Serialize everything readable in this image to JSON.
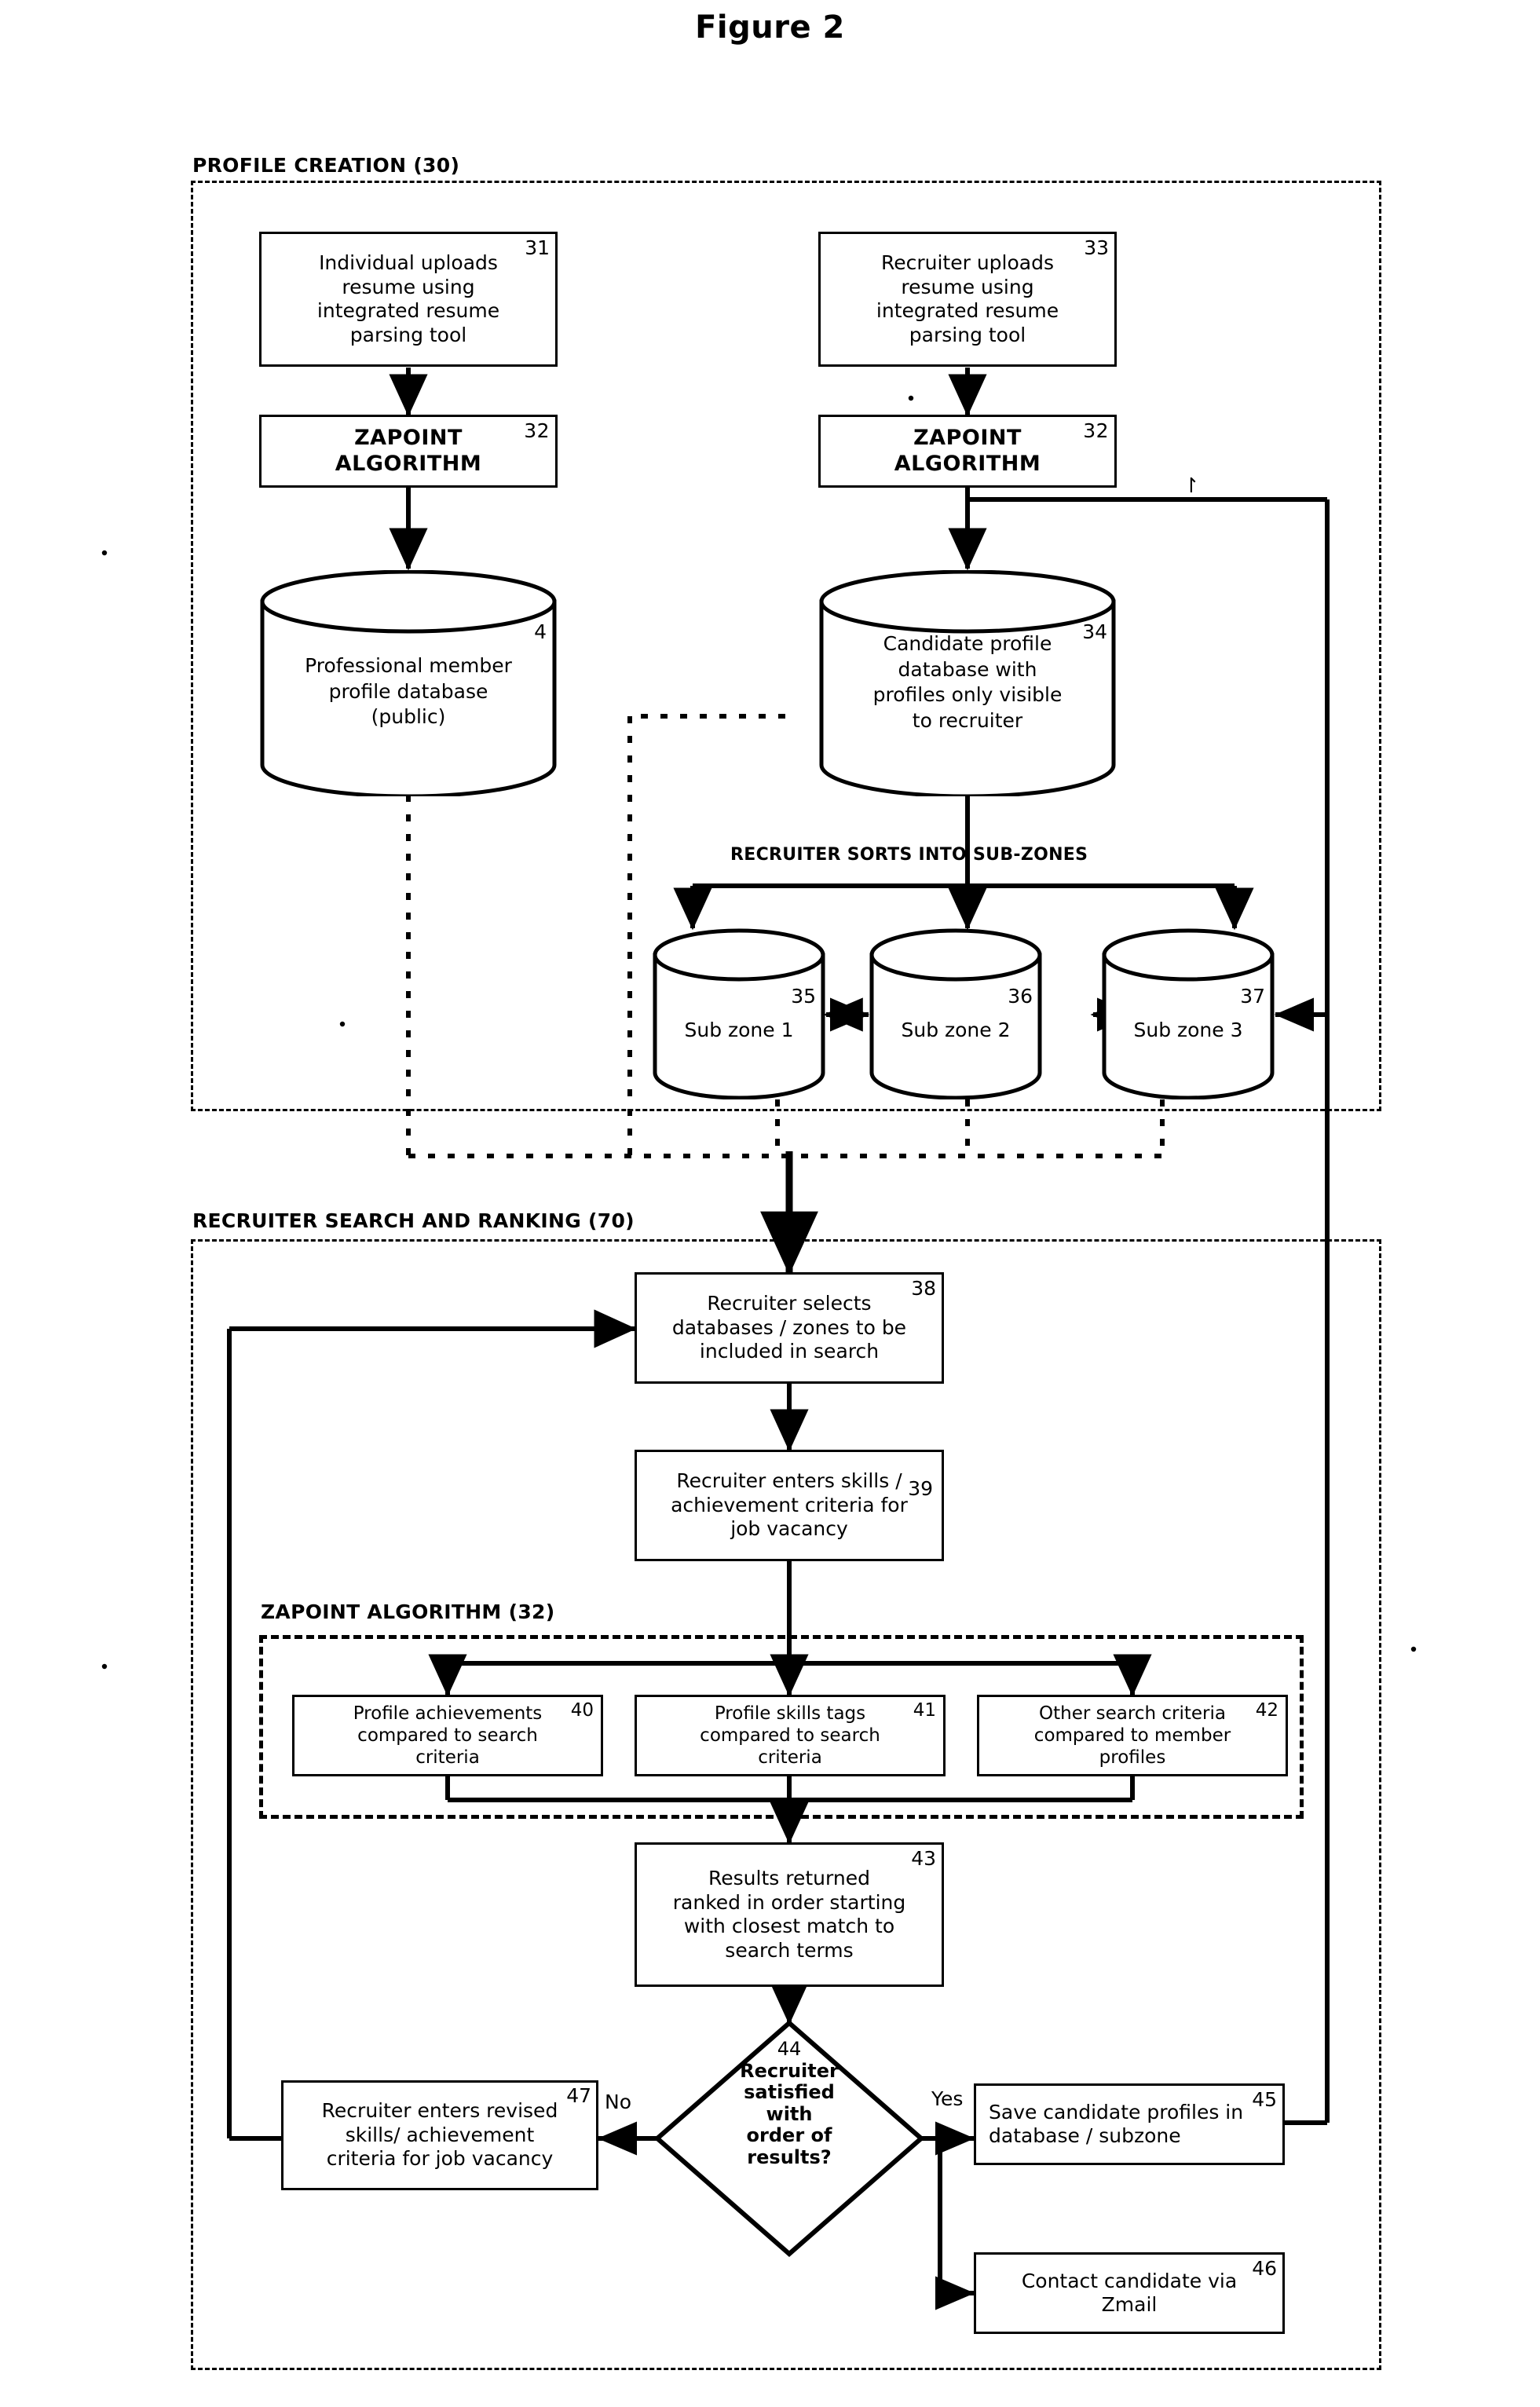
{
  "figure": {
    "title": "Figure 2"
  },
  "zones": {
    "profile_creation": {
      "label": "PROFILE CREATION (30)"
    },
    "recruiter_search": {
      "label": "RECRUITER SEARCH AND RANKING (70)"
    },
    "zapoint_algorithm": {
      "label": "ZAPOINT ALGORITHM (32)"
    }
  },
  "nodes": {
    "n31": {
      "ref": "31",
      "lines": [
        "Individual uploads",
        "resume using",
        "integrated resume",
        "parsing tool"
      ]
    },
    "n32a": {
      "ref": "32",
      "lines": [
        "ZAPOINT",
        "ALGORITHM"
      ]
    },
    "n33": {
      "ref": "33",
      "lines": [
        "Recruiter uploads",
        "resume using",
        "integrated resume",
        "parsing tool"
      ]
    },
    "n32b": {
      "ref": "32",
      "lines": [
        "ZAPOINT",
        "ALGORITHM"
      ]
    },
    "db_public": {
      "ref": "4",
      "lines": [
        "Professional member",
        "profile database",
        "(public)"
      ]
    },
    "db_candidate": {
      "ref": "34",
      "lines": [
        "Candidate profile",
        "database with",
        "profiles only visible",
        "to recruiter"
      ]
    },
    "subzone1": {
      "ref": "35",
      "lines": [
        "Sub zone 1"
      ]
    },
    "subzone2": {
      "ref": "36",
      "lines": [
        "Sub zone 2"
      ]
    },
    "subzone3": {
      "ref": "37",
      "lines": [
        "Sub zone 3"
      ]
    },
    "n38": {
      "ref": "38",
      "lines": [
        "Recruiter selects",
        "databases / zones to be",
        "included in search"
      ]
    },
    "n39": {
      "ref": "39",
      "lines": [
        "Recruiter enters skills /",
        "achievement criteria for",
        "job vacancy"
      ]
    },
    "n40": {
      "ref": "40",
      "lines": [
        "Profile achievements",
        "compared to search",
        "criteria"
      ]
    },
    "n41": {
      "ref": "41",
      "lines": [
        "Profile skills tags",
        "compared to search",
        "criteria"
      ]
    },
    "n42": {
      "ref": "42",
      "lines": [
        "Other search criteria",
        "compared to member",
        "profiles"
      ]
    },
    "n43": {
      "ref": "43",
      "lines": [
        "Results returned",
        "ranked in order starting",
        "with closest match to",
        "search terms"
      ]
    },
    "n44": {
      "ref": "44",
      "lines": [
        "Recruiter",
        "satisfied",
        "with",
        "order of",
        "results?"
      ]
    },
    "n45": {
      "ref": "45",
      "lines": [
        "Save candidate  profiles in",
        "database / subzone"
      ]
    },
    "n46": {
      "ref": "46",
      "lines": [
        "Contact candidate via",
        "Zmail"
      ]
    },
    "n47": {
      "ref": "47",
      "lines": [
        "Recruiter enters revised",
        "skills/ achievement",
        "criteria for job vacancy"
      ]
    }
  },
  "edge_labels": {
    "sorts_into_subzones": "RECRUITER SORTS INTO SUB-ZONES",
    "decision_no": "No",
    "decision_yes": "Yes"
  },
  "colors": {
    "ink": "#000000",
    "paper": "#ffffff"
  }
}
